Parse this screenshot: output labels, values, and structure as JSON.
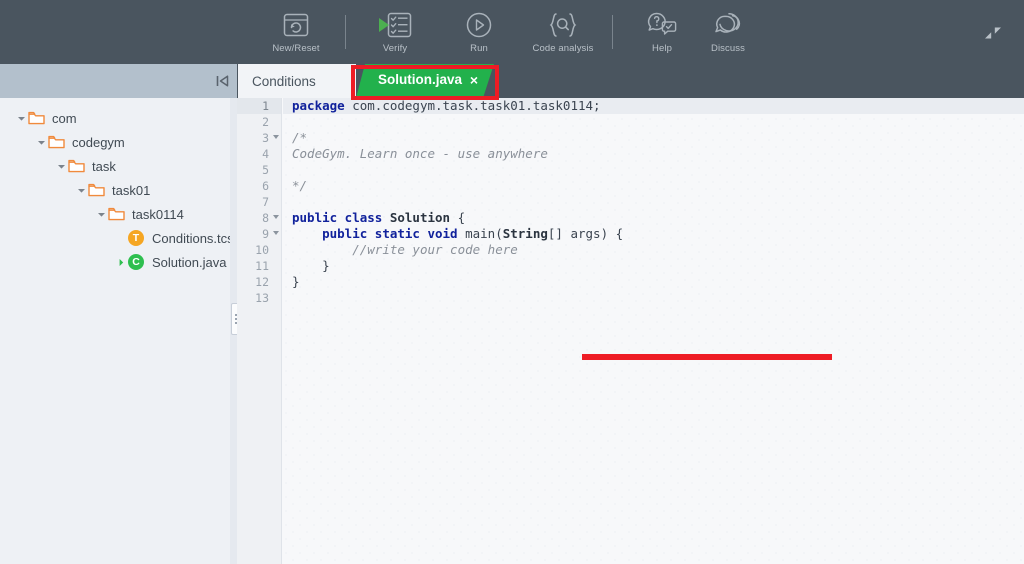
{
  "toolbar": {
    "items": [
      {
        "label": "New/Reset",
        "icon": "new-reset-icon"
      },
      {
        "label": "Verify",
        "icon": "verify-icon"
      },
      {
        "label": "Run",
        "icon": "run-icon"
      },
      {
        "label": "Code analysis",
        "icon": "code-analysis-icon"
      },
      {
        "label": "Help",
        "icon": "help-icon"
      },
      {
        "label": "Discuss",
        "icon": "discuss-icon"
      }
    ],
    "fullscreen_icon": "collapse-fullscreen-icon",
    "background_color": "#4a555f",
    "accent_color": "#4caf50"
  },
  "tabs": {
    "collapse_icon": "collapse-panel-icon",
    "items": [
      {
        "label": "Conditions",
        "active": false,
        "closable": false
      },
      {
        "label": "Solution.java",
        "active": true,
        "closable": true,
        "close_glyph": "×"
      }
    ],
    "active_color": "#22b14c",
    "highlight_color": "#ee1c25"
  },
  "sidebar": {
    "tree": [
      {
        "label": "com",
        "type": "folder",
        "depth": 0,
        "expanded": true
      },
      {
        "label": "codegym",
        "type": "folder",
        "depth": 1,
        "expanded": true
      },
      {
        "label": "task",
        "type": "folder",
        "depth": 2,
        "expanded": true
      },
      {
        "label": "task01",
        "type": "folder",
        "depth": 3,
        "expanded": true
      },
      {
        "label": "task0114",
        "type": "folder",
        "depth": 4,
        "expanded": true
      },
      {
        "label": "Conditions.tcs",
        "type": "file",
        "depth": 5,
        "badge": "T",
        "badge_color": "#f5a623",
        "expandable": false
      },
      {
        "label": "Solution.java",
        "type": "file",
        "depth": 5,
        "badge": "C",
        "badge_color": "#2ebf4f",
        "expandable": true
      }
    ],
    "folder_color": "#f08a3c",
    "splitter_icon": "splitter-handle-icon"
  },
  "editor": {
    "filename": "Solution.java",
    "total_lines": 13,
    "current_line": 1,
    "fold_lines": [
      3,
      8,
      9
    ],
    "annotation": {
      "type": "red-underline",
      "color": "#ee1c25",
      "on_line": 11
    },
    "lines": [
      {
        "n": 1,
        "tokens": [
          {
            "t": "kw",
            "v": "package"
          },
          {
            "t": "id",
            "v": " com.codegym.task.task01.task0114;"
          }
        ]
      },
      {
        "n": 2,
        "tokens": []
      },
      {
        "n": 3,
        "tokens": [
          {
            "t": "cm",
            "v": "/*"
          }
        ]
      },
      {
        "n": 4,
        "tokens": [
          {
            "t": "cm",
            "v": "CodeGym. Learn once - use anywhere"
          }
        ]
      },
      {
        "n": 5,
        "tokens": []
      },
      {
        "n": 6,
        "tokens": [
          {
            "t": "cm",
            "v": "*/"
          }
        ]
      },
      {
        "n": 7,
        "tokens": []
      },
      {
        "n": 8,
        "tokens": [
          {
            "t": "kw",
            "v": "public class"
          },
          {
            "t": "cls",
            "v": " Solution"
          },
          {
            "t": "id",
            "v": " {"
          }
        ]
      },
      {
        "n": 9,
        "tokens": [
          {
            "t": "id",
            "v": "    "
          },
          {
            "t": "kw",
            "v": "public static void"
          },
          {
            "t": "id",
            "v": " main("
          },
          {
            "t": "cls",
            "v": "String"
          },
          {
            "t": "id",
            "v": "[] args) {"
          }
        ]
      },
      {
        "n": 10,
        "tokens": [
          {
            "t": "id",
            "v": "        "
          },
          {
            "t": "cm",
            "v": "//write your code here"
          }
        ]
      },
      {
        "n": 11,
        "tokens": [
          {
            "t": "id",
            "v": "    }"
          }
        ]
      },
      {
        "n": 12,
        "tokens": [
          {
            "t": "id",
            "v": "}"
          }
        ]
      },
      {
        "n": 13,
        "tokens": []
      }
    ]
  }
}
